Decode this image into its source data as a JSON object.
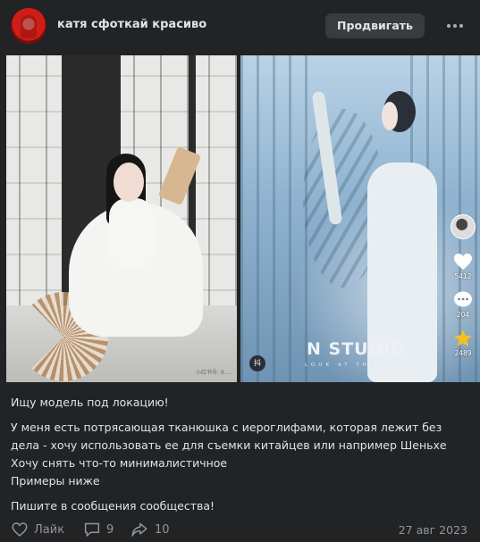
{
  "post": {
    "author": "катя сфоткай красиво",
    "promote_label": "Продвигать",
    "more_icon": "more-horizontal-icon"
  },
  "photos": {
    "left": {
      "watermark": "小红书号: 9...."
    },
    "right": {
      "studio_name": "N STUDIO",
      "studio_sub": "LOOK AT THE FUTURE",
      "badge": "抖",
      "likes": "5412",
      "comments": "204",
      "favorites": "2489"
    }
  },
  "text": {
    "line1": "Ищу модель под локацию!",
    "line2": "У меня есть потрясающая тканюшка с иероглифами, которая лежит без",
    "line3": "дела - хочу использовать ее для съемки китайцев или например Шеньхе",
    "line4": "Хочу снять что-то минималистичное",
    "line5": "Примеры ниже",
    "line6": "Пишите в сообщения сообщества!"
  },
  "footer": {
    "like_label": "Лайк",
    "comments_count": "9",
    "shares_count": "10",
    "date": "27 авг 2023"
  },
  "colors": {
    "background": "#222324",
    "text": "#e1e3e6",
    "muted": "#939699",
    "button": "#3a3b3d"
  }
}
